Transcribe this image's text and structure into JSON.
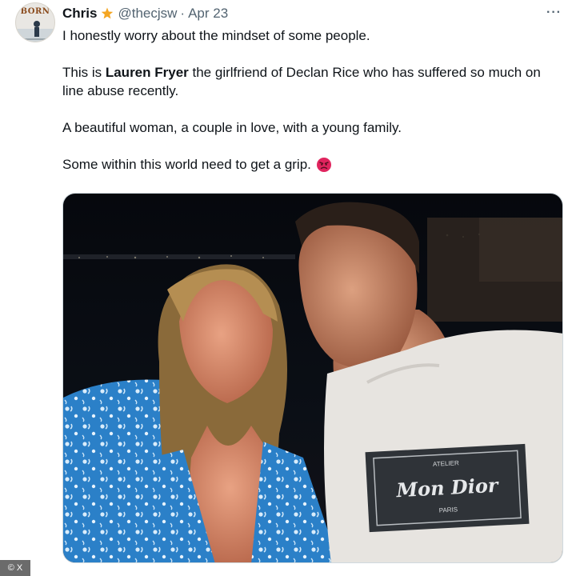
{
  "tweet": {
    "author_name": "Chris",
    "badge_icon": "star-icon",
    "handle": "@thecjsw",
    "separator": "·",
    "date": "Apr 23",
    "more_label": "···",
    "avatar_text": "BORN",
    "paragraphs": {
      "p1": "I honestly worry about the mindset of some people.",
      "p2_before": "This is ",
      "p2_bold": "Lauren Fryer",
      "p2_after": " the girlfriend of Declan Rice who has suffered so much on line abuse recently.",
      "p3": "A beautiful woman, a couple in love, with a young family.",
      "p4": "Some within this world need to get a grip."
    },
    "emoji_icon": "angry-face-icon",
    "photo": {
      "shirt_brand": "Mon Dior",
      "shirt_top": "ATELIER",
      "shirt_bottom": "PARIS"
    }
  },
  "credit": "© X",
  "colors": {
    "text": "#0f1419",
    "muted": "#536471",
    "badge": "#f4a623",
    "emoji": "#e0245e"
  }
}
